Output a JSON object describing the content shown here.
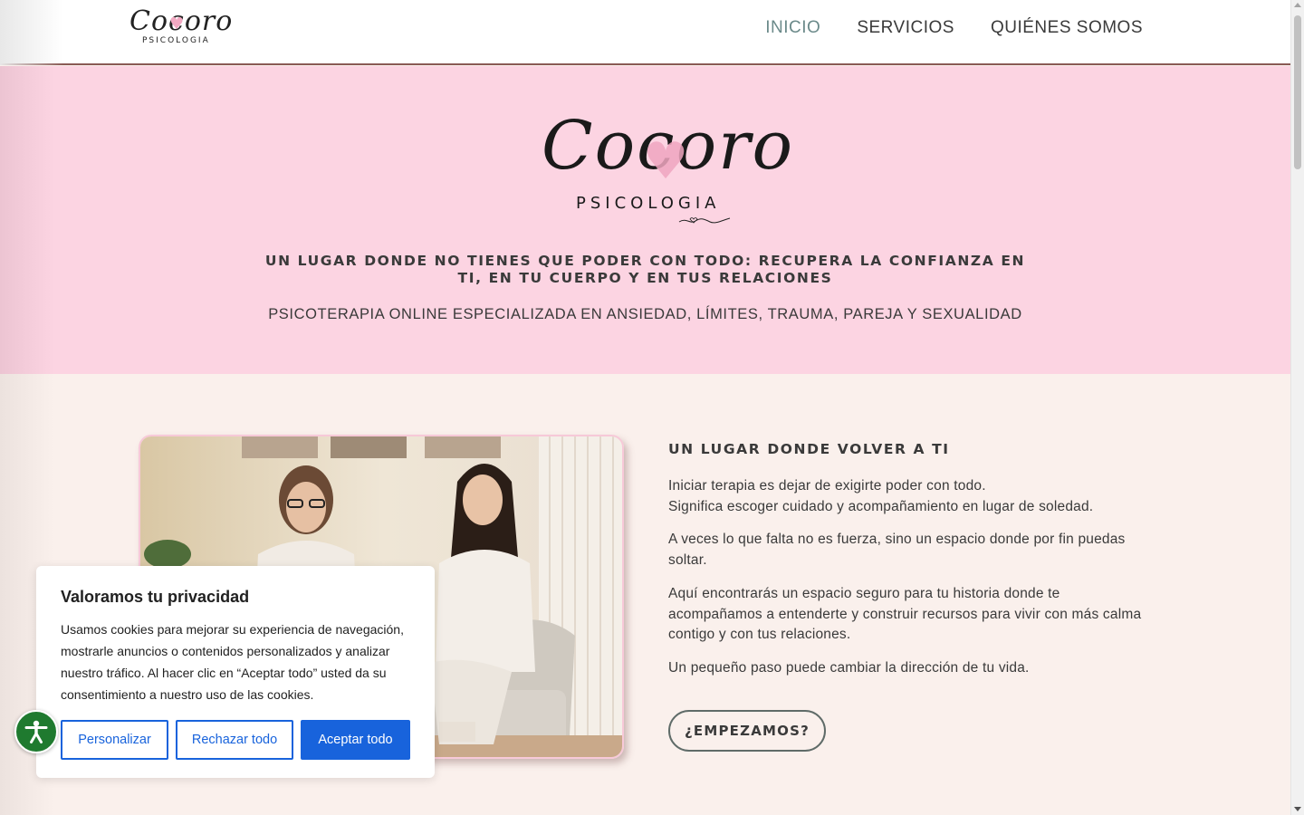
{
  "header": {
    "logo": {
      "script": "Cocoro",
      "sub": "PSICOLOGIA"
    },
    "nav": [
      {
        "label": "INICIO",
        "active": true
      },
      {
        "label": "SERVICIOS",
        "active": false
      },
      {
        "label": "QUIÉNES SOMOS",
        "active": false
      }
    ]
  },
  "hero": {
    "logo": {
      "script": "Cocoro",
      "sub": "PSICOLOGIA"
    },
    "title": "UN LUGAR DONDE NO TIENES QUE PODER CON TODO: RECUPERA LA CONFIANZA EN TI, EN TU CUERPO Y EN TUS RELACIONES",
    "subtitle": "PSICOTERAPIA ONLINE ESPECIALIZADA EN ANSIEDAD, LÍMITES, TRAUMA, PAREJA Y SEXUALIDAD"
  },
  "content": {
    "title": "UN LUGAR DONDE VOLVER A TI",
    "p1_line1": "Iniciar terapia es dejar de exigirte poder con todo.",
    "p1_line2": "Significa escoger cuidado y acompañamiento en lugar de soledad.",
    "p2": "A veces lo que falta no es fuerza, sino un espacio donde por fin puedas soltar.",
    "p3": "Aquí encontrarás un espacio seguro para tu historia donde te acompañamos a entenderte y construir recursos para vivir con más calma contigo y con tus relaciones.",
    "p4": "Un pequeño paso puede cambiar la dirección de tu vida.",
    "cta": "¿EMPEZAMOS?"
  },
  "cookie": {
    "title": "Valoramos tu privacidad",
    "text": "Usamos cookies para mejorar su experiencia de navegación, mostrarle anuncios o contenidos personalizados y analizar nuestro tráfico. Al hacer clic en “Aceptar todo” usted da su consentimiento a nuestro uso de las cookies.",
    "customize": "Personalizar",
    "reject": "Rechazar todo",
    "accept": "Aceptar todo"
  },
  "colors": {
    "hero_bg": "#fcd4e2",
    "section_bg": "#faf0ec",
    "nav_active": "#6b8a8a",
    "cookie_blue": "#1863dc",
    "a11y_green": "#1f7a2f"
  },
  "icons": {
    "accessibility": "accessibility-icon",
    "heart": "heart-icon"
  }
}
